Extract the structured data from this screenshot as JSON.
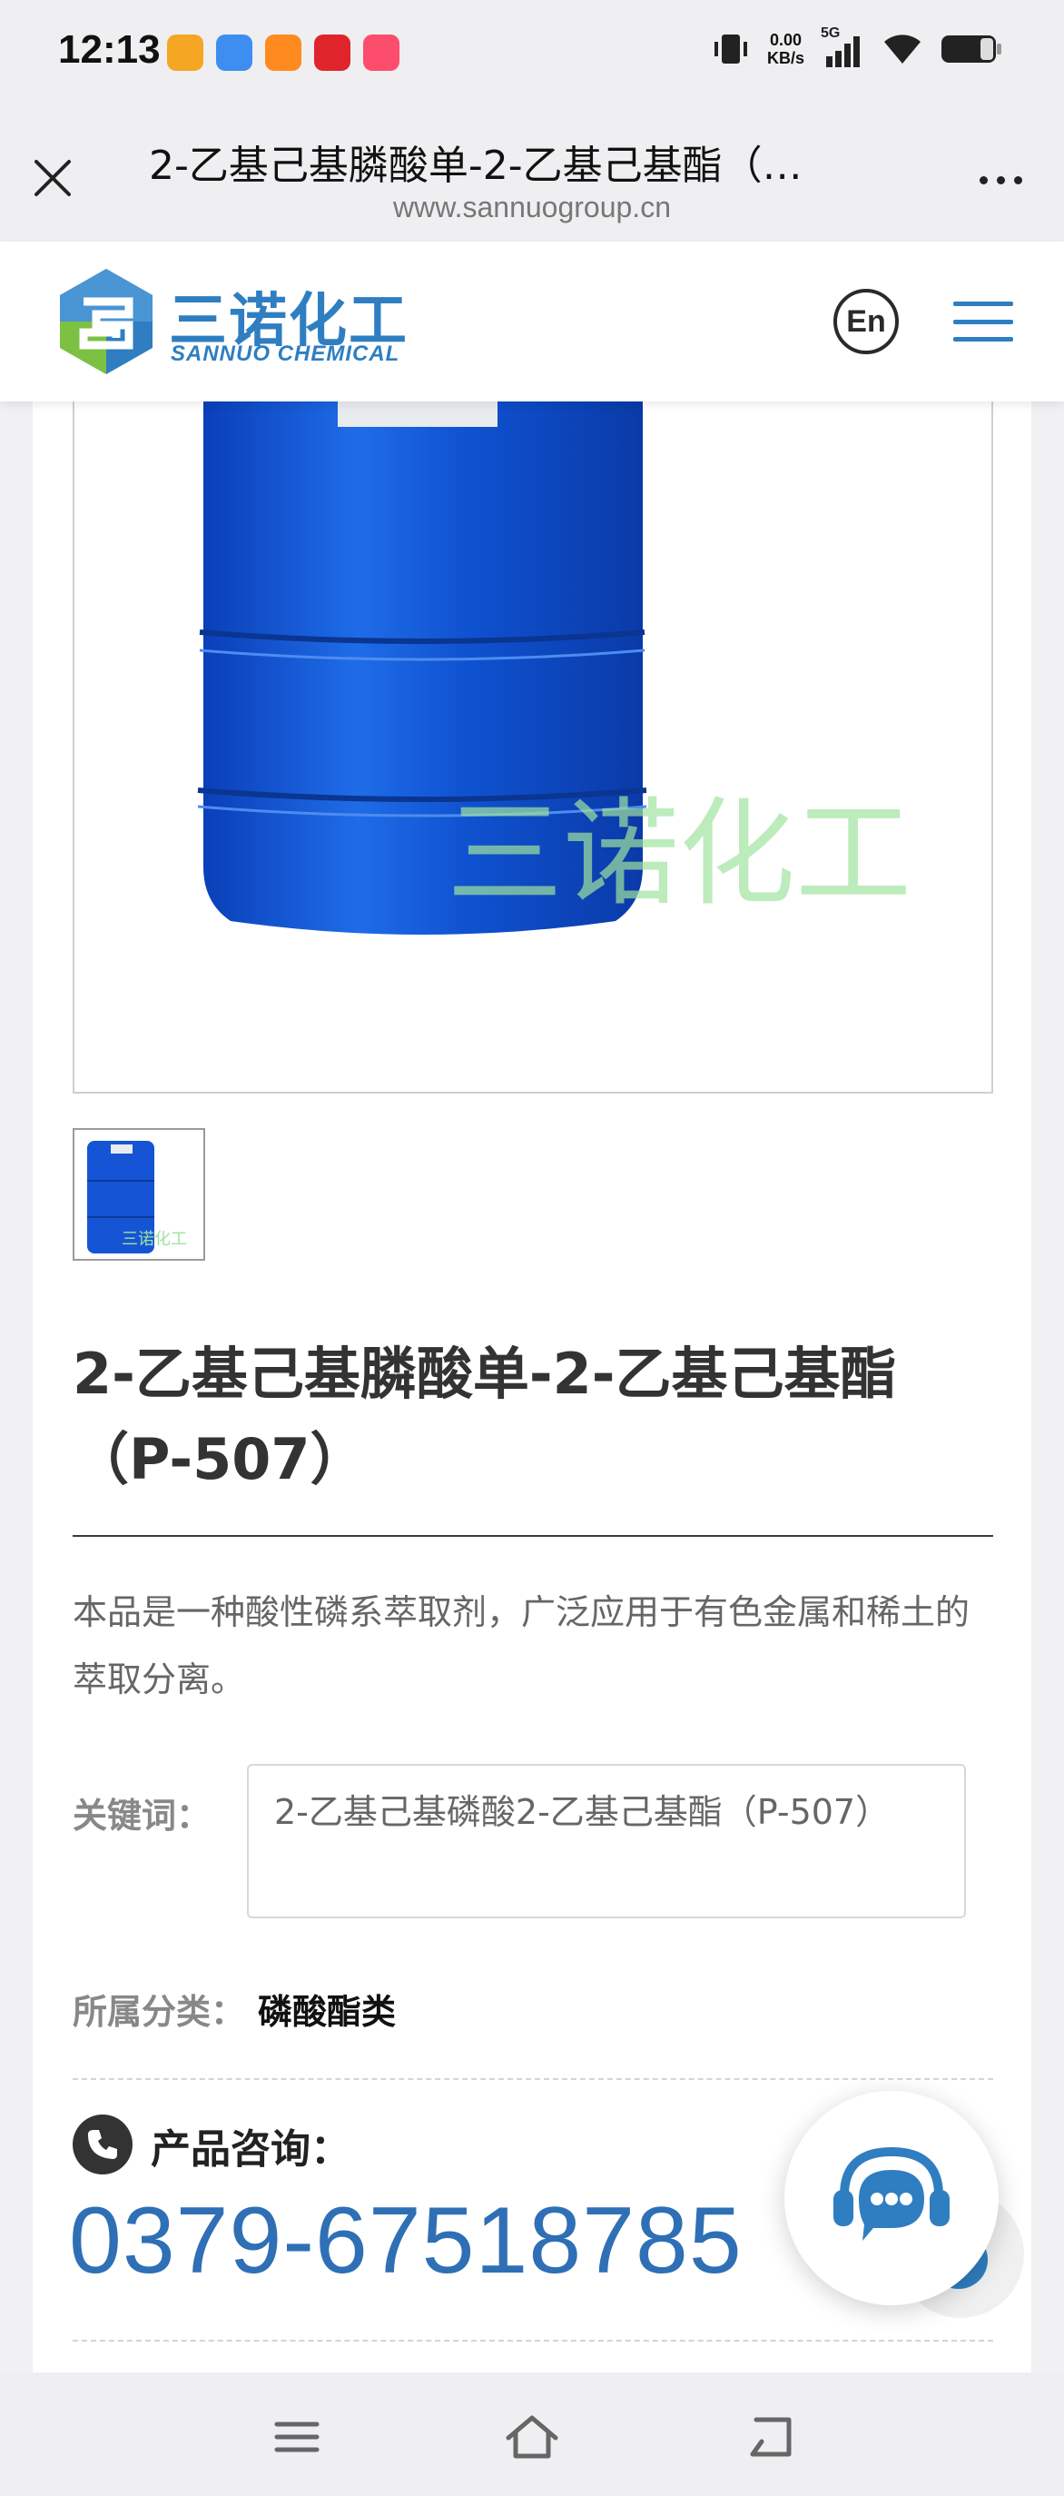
{
  "status_bar": {
    "time": "12:13",
    "net_speed_value": "0.00",
    "net_speed_unit": "KB/s",
    "signal_label": "5G",
    "app_icons": [
      "weibo-icon",
      "browser-app-icon",
      "taobao-icon",
      "game-app-icon",
      "video-app-icon"
    ]
  },
  "browser": {
    "title": "2-乙基己基膦酸单-2-乙基己基酯（…",
    "url": "www.sannuogroup.cn"
  },
  "site": {
    "logo_cn": "三诺化工",
    "logo_en": "SANNUO CHEMICAL",
    "lang_label": "En",
    "watermark": "三诺化工"
  },
  "product": {
    "title": "2-乙基己基膦酸单-2-乙基己基酯（P-507）",
    "description": "本品是一种酸性磷系萃取剂，广泛应用于有色金属和稀土的萃取分离。",
    "keywords_label": "关键词：",
    "keywords_value": "2-乙基己基磷酸2-乙基己基酯（P-507）",
    "category_label": "所属分类：",
    "category_value": "磷酸酯类",
    "consult_label": "产品咨询：",
    "phone": "0379-67518785"
  },
  "colors": {
    "brand_blue": "#2f7ec1",
    "phone_blue": "#2f6fb5",
    "logo_green": "#7cc142"
  }
}
